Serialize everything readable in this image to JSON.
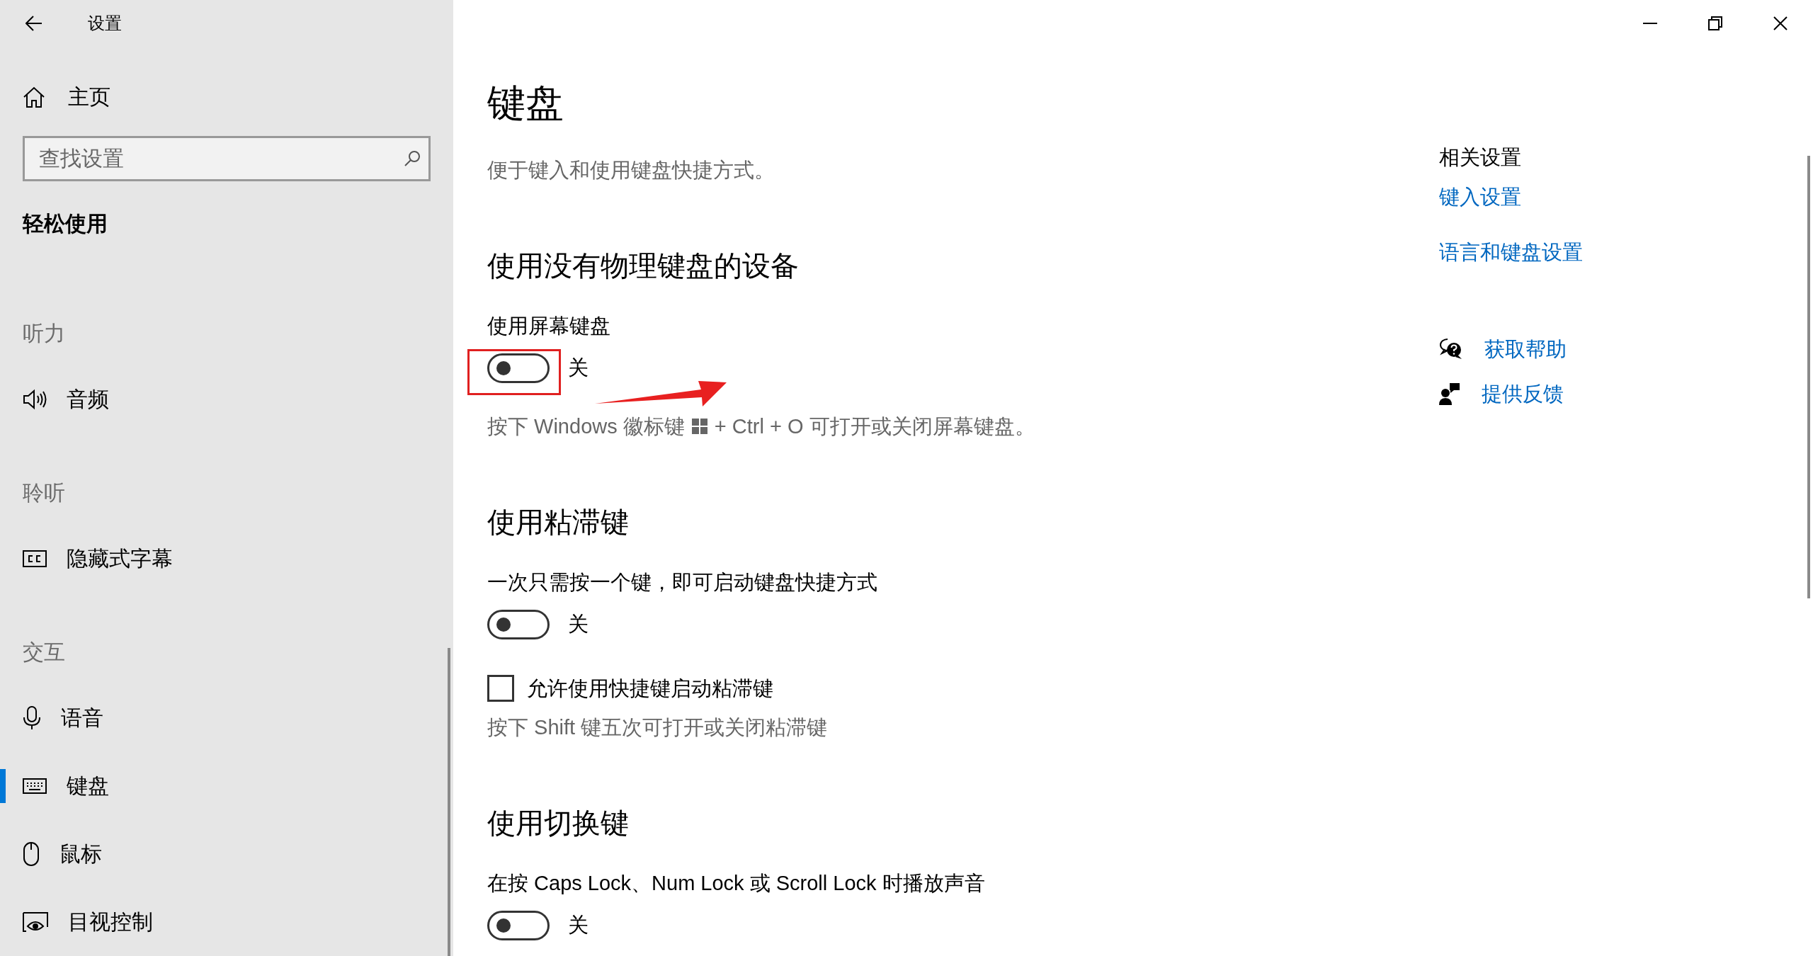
{
  "sidebar": {
    "window_title": "设置",
    "home": "主页",
    "search": {
      "placeholder": "查找设置"
    },
    "category": "轻松使用",
    "groups": [
      {
        "heading": "听力",
        "items": [
          {
            "kind": "audio",
            "label": "音频",
            "selected": false
          }
        ]
      },
      {
        "heading": "聆听",
        "items": [
          {
            "kind": "captions",
            "label": "隐藏式字幕",
            "selected": false
          }
        ]
      },
      {
        "heading": "交互",
        "items": [
          {
            "kind": "speech",
            "label": "语音",
            "selected": false
          },
          {
            "kind": "keyboard",
            "label": "键盘",
            "selected": true
          },
          {
            "kind": "mouse",
            "label": "鼠标",
            "selected": false
          },
          {
            "kind": "eye",
            "label": "目视控制",
            "selected": false
          }
        ]
      }
    ]
  },
  "main": {
    "title": "键盘",
    "description": "便于键入和使用键盘快捷方式。",
    "sections": [
      {
        "heading": "使用没有物理键盘的设备",
        "items": [
          {
            "kind": "toggle",
            "label": "使用屏幕键盘",
            "on": false,
            "state_text": "关",
            "highlighted": true
          },
          {
            "kind": "key_hint",
            "before": "按下 Windows 徽标键",
            "after": "+ Ctrl + O 可打开或关闭屏幕键盘。"
          }
        ]
      },
      {
        "heading": "使用粘滞键",
        "items": [
          {
            "kind": "toggle",
            "label": "一次只需按一个键，即可启动键盘快捷方式",
            "on": false,
            "state_text": "关"
          },
          {
            "kind": "checkbox",
            "label": "允许使用快捷键启动粘滞键",
            "checked": false
          },
          {
            "kind": "hint",
            "text": "按下 Shift 键五次可打开或关闭粘滞键"
          }
        ]
      },
      {
        "heading": "使用切换键",
        "items": [
          {
            "kind": "toggle",
            "label": "在按 Caps Lock、Num Lock 或 Scroll Lock 时播放声音",
            "on": false,
            "state_text": "关"
          }
        ]
      }
    ]
  },
  "related": {
    "heading": "相关设置",
    "links": [
      "键入设置",
      "语言和键盘设置"
    ],
    "support": [
      {
        "kind": "help",
        "label": "获取帮助"
      },
      {
        "kind": "feedback",
        "label": "提供反馈"
      }
    ]
  }
}
